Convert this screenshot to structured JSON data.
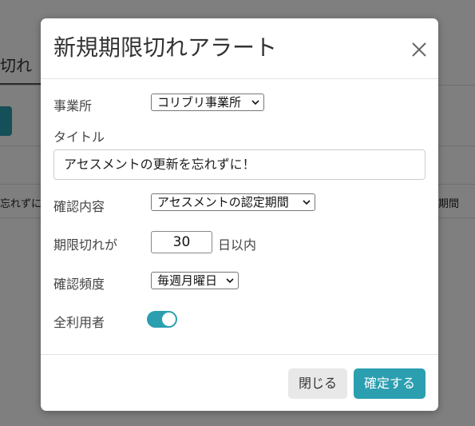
{
  "background": {
    "tab_label": "切れ",
    "cell_left": "忘れずに",
    "cell_right": "期間"
  },
  "modal": {
    "title": "新規期限切れアラート",
    "office": {
      "label": "事業所",
      "selected": "コリブリ事業所"
    },
    "title_field": {
      "label": "タイトル",
      "value": "アセスメントの更新を忘れずに！"
    },
    "check_content": {
      "label": "確認内容",
      "selected": "アセスメントの認定期間"
    },
    "expiry": {
      "label": "期限切れが",
      "value": "30",
      "suffix": "日以内"
    },
    "frequency": {
      "label": "確認頻度",
      "selected": "毎週月曜日"
    },
    "all_users": {
      "label": "全利用者",
      "on": true
    },
    "buttons": {
      "close": "閉じる",
      "confirm": "確定する"
    }
  },
  "colors": {
    "accent": "#2b9fb0",
    "overlay": "rgba(0,0,0,0.5)"
  }
}
